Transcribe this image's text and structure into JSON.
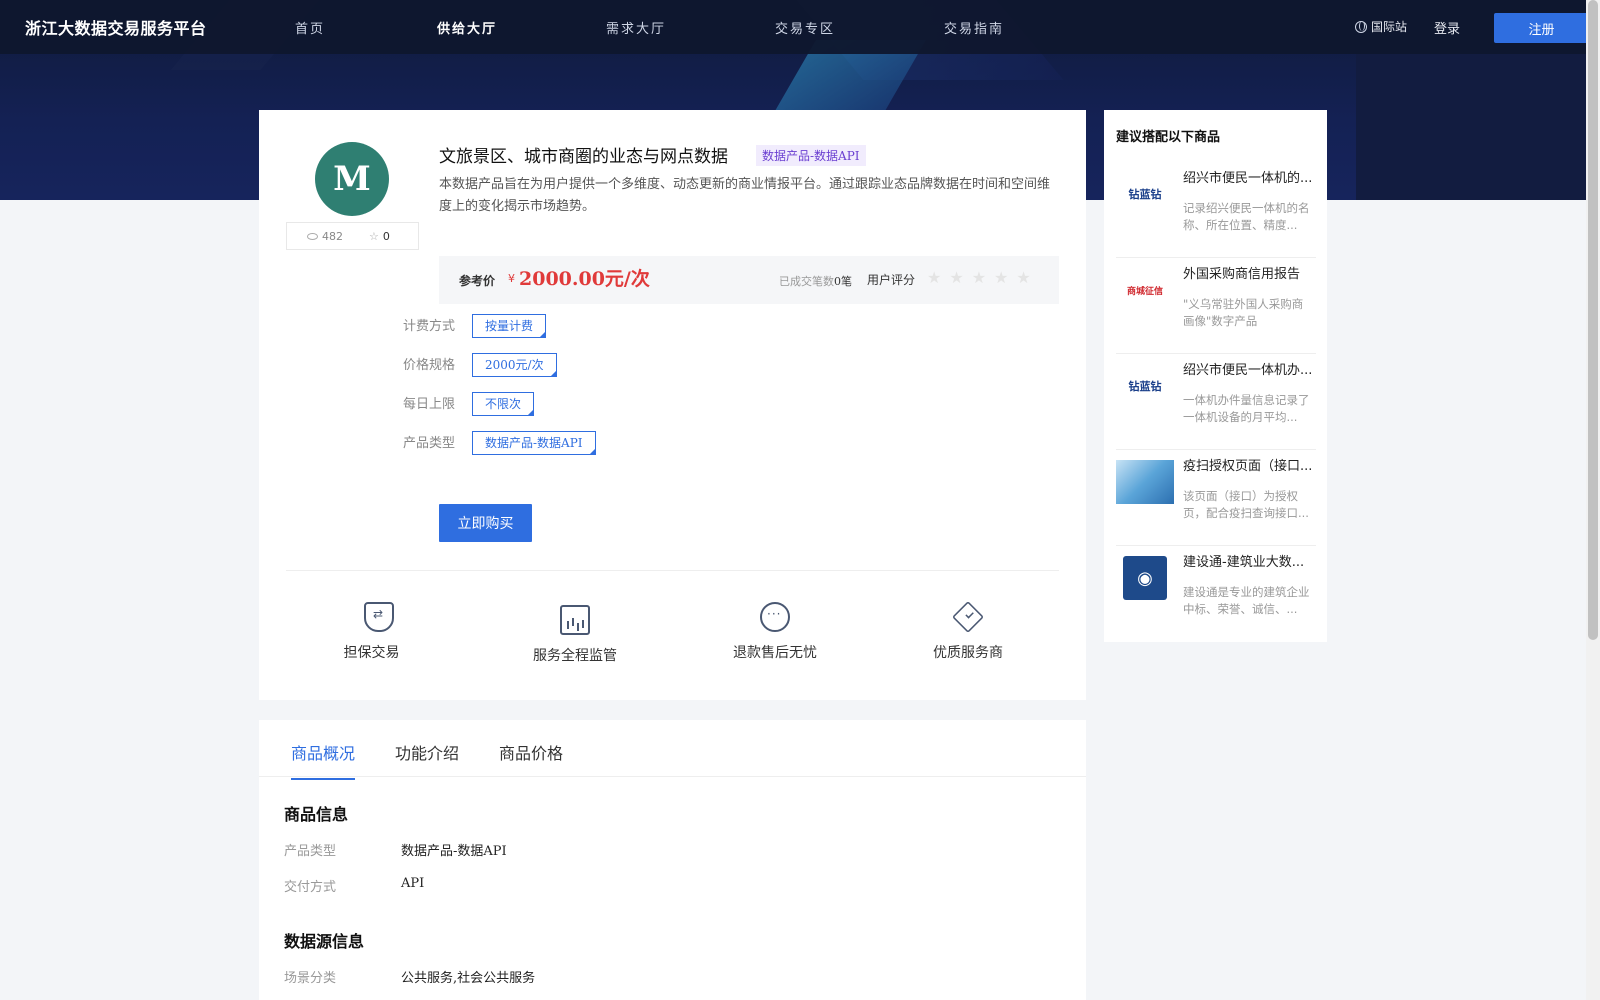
{
  "nav": {
    "logo": "浙江大数据交易服务平台",
    "links": [
      "首页",
      "供给大厅",
      "需求大厅",
      "交易专区",
      "交易指南"
    ],
    "intl": "国际站",
    "login": "登录",
    "register": "注册"
  },
  "product": {
    "logo_letter": "M",
    "views": "482",
    "favorites": "0",
    "title": "文旅景区、城市商圈的业态与网点数据",
    "tag": "数据产品-数据API",
    "description": "本数据产品旨在为用户提供一个多维度、动态更新的商业情报平台。通过跟踪业态品牌数据在时间和空间维度上的变化揭示市场趋势。",
    "price_label": "参考价",
    "price_currency": "¥",
    "price": "2000.00元/次",
    "deals_label": "已成交笔数",
    "deals_value": "0笔",
    "rating_label": "用户评分",
    "rating_stars": "★★★★★",
    "specs": [
      {
        "label": "计费方式",
        "value": "按量计费"
      },
      {
        "label": "价格规格",
        "value": "2000元/次"
      },
      {
        "label": "每日上限",
        "value": "不限次"
      },
      {
        "label": "产品类型",
        "value": "数据产品-数据API"
      }
    ],
    "buy_button": "立即购买",
    "features": [
      "担保交易",
      "服务全程监管",
      "退款售后无忧",
      "优质服务商"
    ]
  },
  "tabs": {
    "items": [
      "商品概况",
      "功能介绍",
      "商品价格"
    ],
    "section1_title": "商品信息",
    "section1_rows": [
      {
        "label": "产品类型",
        "value": "数据产品-数据API"
      },
      {
        "label": "交付方式",
        "value": "API"
      }
    ],
    "section2_title": "数据源信息",
    "section2_rows": [
      {
        "label": "场景分类",
        "value": "公共服务,社会公共服务"
      }
    ]
  },
  "recommend": {
    "title": "建议搭配以下商品",
    "items": [
      {
        "thumb": "钻蓝钻",
        "name": "绍兴市便民一体机的...",
        "desc": "记录绍兴便民一体机的名称、所在位置、精度..."
      },
      {
        "thumb": "商城征信",
        "name": "外国采购商信用报告",
        "desc": "\"义乌常驻外国人采购商画像\"数字产品"
      },
      {
        "thumb": "钻蓝钻",
        "name": "绍兴市便民一体机办...",
        "desc": "一体机办件量信息记录了一体机设备的月平均..."
      },
      {
        "thumb": "",
        "name": "疫扫授权页面（接口...",
        "desc": "该页面（接口）为授权页，配合疫扫查询接口..."
      },
      {
        "thumb": "◉",
        "name": "建设通-建筑业大数...",
        "desc": "建设通是专业的建筑企业中标、荣誉、诚信、..."
      }
    ]
  }
}
